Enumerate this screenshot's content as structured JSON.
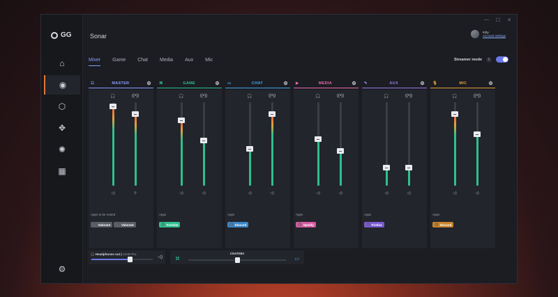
{
  "app": {
    "logo_text": "GG",
    "title": "Sonar",
    "window_controls": [
      "—",
      "☐",
      "✕"
    ]
  },
  "account": {
    "name": "Kitty",
    "link_label": "Account settings"
  },
  "tabs": [
    {
      "label": "Mixer",
      "active": true
    },
    {
      "label": "Game",
      "active": false
    },
    {
      "label": "Chat",
      "active": false
    },
    {
      "label": "Media",
      "active": false
    },
    {
      "label": "Aux",
      "active": false
    },
    {
      "label": "Mic",
      "active": false
    }
  ],
  "streamer_mode": {
    "label": "Streamer mode",
    "info": "i",
    "enabled": true
  },
  "sidebar": {
    "items": [
      {
        "name": "home-icon",
        "glyph": "⌂",
        "active": false
      },
      {
        "name": "sonar-icon",
        "glyph": "◉",
        "active": true
      },
      {
        "name": "hexagon-icon",
        "glyph": "⬡",
        "active": false
      },
      {
        "name": "controller-icon",
        "glyph": "✥",
        "active": false
      },
      {
        "name": "engine-icon",
        "glyph": "✺",
        "active": false
      },
      {
        "name": "gift-icon",
        "glyph": "▦",
        "active": false
      }
    ],
    "settings_glyph": "⚙"
  },
  "channels": [
    {
      "id": "master",
      "label": "MASTER",
      "color": "#8a9bff",
      "icon": "☷",
      "faders": [
        {
          "icon": "🎧",
          "level": 0.95,
          "peak": true
        },
        {
          "icon": "((•))",
          "level": 0.86,
          "peak": true
        }
      ],
      "apps_label": "Apps to be muted",
      "apps": [
        {
          "name": "Valorant",
          "color": "#5a5e66"
        },
        {
          "name": "Valorant",
          "color": "#5a5e66"
        }
      ]
    },
    {
      "id": "game",
      "label": "GAME",
      "color": "#2fbf8f",
      "icon": "⌘",
      "faders": [
        {
          "icon": "🎧",
          "level": 0.78,
          "peak": true
        },
        {
          "icon": "((•))",
          "level": 0.54,
          "peak": false
        }
      ],
      "apps_label": "Apps",
      "apps": [
        {
          "name": "Fortnite",
          "color": "#2fbf8f"
        }
      ]
    },
    {
      "id": "chat",
      "label": "CHAT",
      "color": "#43a6e8",
      "icon": "▭",
      "faders": [
        {
          "icon": "🎧",
          "level": 0.44,
          "peak": false
        },
        {
          "icon": "((•))",
          "level": 0.86,
          "peak": true
        }
      ],
      "apps_label": "Apps",
      "apps": [
        {
          "name": "Discord",
          "color": "#3a86c8"
        }
      ]
    },
    {
      "id": "media",
      "label": "MEDIA",
      "color": "#e86bb0",
      "icon": "▶",
      "faders": [
        {
          "icon": "🎧",
          "level": 0.56,
          "peak": false
        },
        {
          "icon": "((•))",
          "level": 0.42,
          "peak": false
        }
      ],
      "apps_label": "Apps",
      "apps": [
        {
          "name": "Spotify",
          "color": "#d45aa0"
        }
      ]
    },
    {
      "id": "aux",
      "label": "AUX",
      "color": "#9a7be8",
      "icon": "✎",
      "faders": [
        {
          "icon": "🎧",
          "level": 0.22,
          "peak": false
        },
        {
          "icon": "((•))",
          "level": 0.22,
          "peak": false
        }
      ],
      "apps_label": "Apps",
      "apps": [
        {
          "name": "Firefox",
          "color": "#7a5ad0"
        }
      ]
    },
    {
      "id": "mic",
      "label": "MIC",
      "color": "#e8a03b",
      "icon": "🎙",
      "faders": [
        {
          "icon": "🎧",
          "level": 0.86,
          "peak": true
        },
        {
          "icon": "((•))",
          "level": 0.62,
          "peak": false
        }
      ],
      "apps_label": "Apps",
      "apps": [
        {
          "name": "Discord",
          "color": "#c8842a"
        }
      ]
    }
  ],
  "headphones": {
    "label": "Headphones out",
    "device": "Arctis Pro",
    "level": 0.62
  },
  "chatmix": {
    "label": "CHATMIX",
    "position": 0.5
  }
}
